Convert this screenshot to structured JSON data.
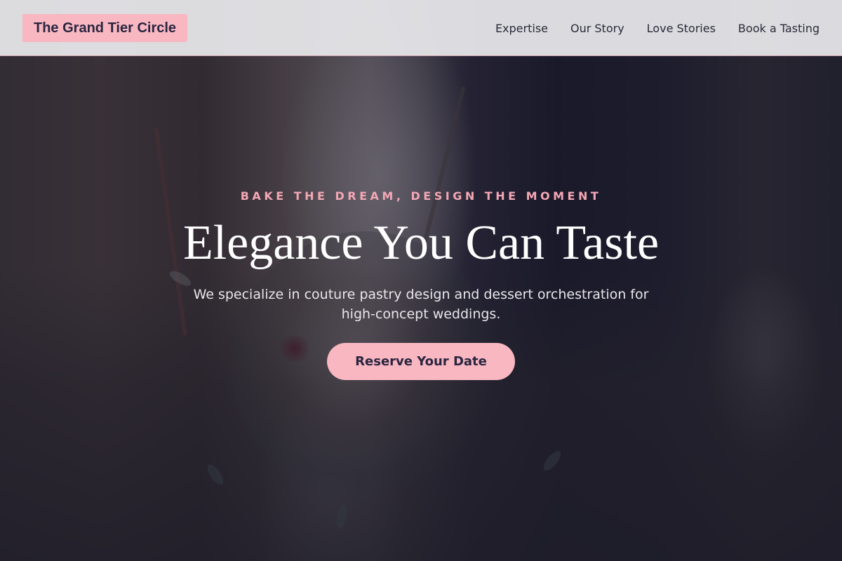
{
  "header": {
    "logo": "The Grand Tier Circle",
    "nav": [
      {
        "label": "Expertise"
      },
      {
        "label": "Our Story"
      },
      {
        "label": "Love Stories"
      },
      {
        "label": "Book a Tasting"
      }
    ]
  },
  "hero": {
    "eyebrow": "BAKE THE DREAM, DESIGN THE MOMENT",
    "headline": "Elegance You Can Taste",
    "subtext": "We specialize in couture pastry design and dessert orchestration for high-concept weddings.",
    "cta_label": "Reserve Your Date"
  },
  "colors": {
    "accent_pink": "#f8b7c1",
    "eyebrow_pink": "#f4a7b5",
    "dark_text": "#2a2540",
    "overlay": "#1a1a2e"
  }
}
